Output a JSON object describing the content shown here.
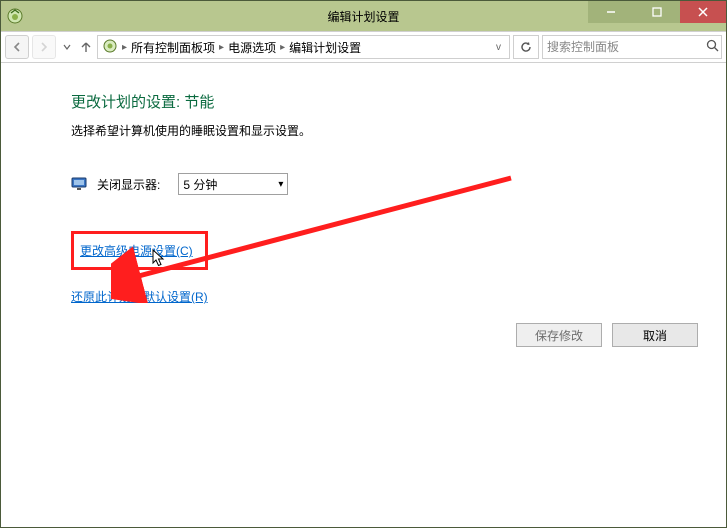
{
  "window": {
    "title": "编辑计划设置"
  },
  "breadcrumb": {
    "items": [
      "所有控制面板项",
      "电源选项",
      "编辑计划设置"
    ]
  },
  "search": {
    "placeholder": "搜索控制面板"
  },
  "page": {
    "heading": "更改计划的设置: 节能",
    "sub": "选择希望计算机使用的睡眠设置和显示设置。",
    "turnoff_display_label": "关闭显示器:",
    "turnoff_display_value": "5 分钟",
    "link_advanced": "更改高级电源设置(C)",
    "link_restore": "还原此计划的默认设置(R)"
  },
  "buttons": {
    "save": "保存修改",
    "cancel": "取消"
  }
}
